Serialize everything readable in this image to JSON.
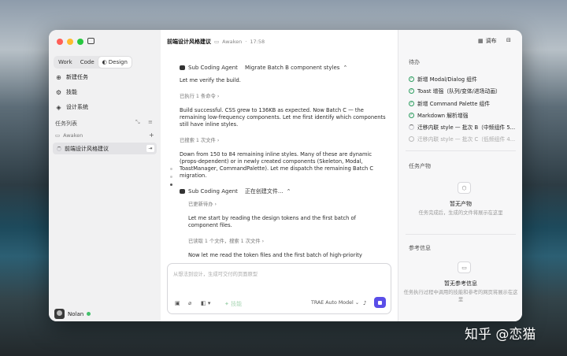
{
  "window": {
    "title": "前端设计风格建议",
    "project": "Awaken",
    "time": "17:58"
  },
  "sidebar": {
    "modes": [
      "Work",
      "Code",
      "Design"
    ],
    "nav": [
      {
        "label": "新建任务",
        "icon": "new-task-icon"
      },
      {
        "label": "技能",
        "icon": "skills-icon"
      },
      {
        "label": "设计系统",
        "icon": "design-system-icon"
      }
    ],
    "section_title": "任务列表",
    "folder": "Awaken",
    "task": "前端设计风格建议",
    "user": "Nolan"
  },
  "header": {
    "share": "调布"
  },
  "feed": {
    "agent1_name": "Sub Coding Agent",
    "agent1_task": "Migrate Batch B component styles",
    "msg1": "Let me verify the build.",
    "tool1": "已执行 1 条命令",
    "msg2": "Build successful. CSS grew to 136KB as expected. Now Batch C — the remaining low-frequency components. Let me first identify which components still have inline styles.",
    "tool2": "已搜索 1 次文件",
    "msg3": "Down from 150 to 84 remaining inline styles. Many of these are dynamic (props-dependent) or in newly created components (Skeleton, Modal, ToastManager, CommandPalette). Let me dispatch the remaining Batch C migration.",
    "agent2_name": "Sub Coding Agent",
    "agent2_status": "正在创建文件...",
    "tool3": "已更新待办",
    "msg4": "Let me start by reading the design tokens and the first batch of component files.",
    "tool4": "已读取 1 个文件，搜索 1 次文件",
    "msg5": "Now let me read the token files and the first batch of high-priority component files."
  },
  "composer": {
    "placeholder": "从想法到设计，生成可交付的页面原型",
    "skill": "技能",
    "model": "TRAE Auto Model"
  },
  "panel": {
    "todo_title": "待办",
    "todos": [
      {
        "label": "新增 Modal/Dialog 组件",
        "state": "done"
      },
      {
        "label": "Toast 增强（队列/变体/进场动画）",
        "state": "done"
      },
      {
        "label": "新增 Command Palette 组件",
        "state": "done"
      },
      {
        "label": "Markdown 解析增强",
        "state": "done"
      },
      {
        "label": "迁移内联 style — 批次 B（中频组件 5...",
        "state": "in_progress"
      },
      {
        "label": "迁移内联 style — 批次 C（低频组件 4...",
        "state": "pending"
      }
    ],
    "artifacts_title": "任务产物",
    "artifacts_empty": "暂无产物",
    "artifacts_hint": "任务完成后，生成的文件将展示在这里",
    "refs_title": "参考信息",
    "refs_empty": "暂无参考信息",
    "refs_hint": "任务执行过程中调用的技能和参考的网页将展示在这里"
  },
  "watermark": "知乎 @恋猫"
}
